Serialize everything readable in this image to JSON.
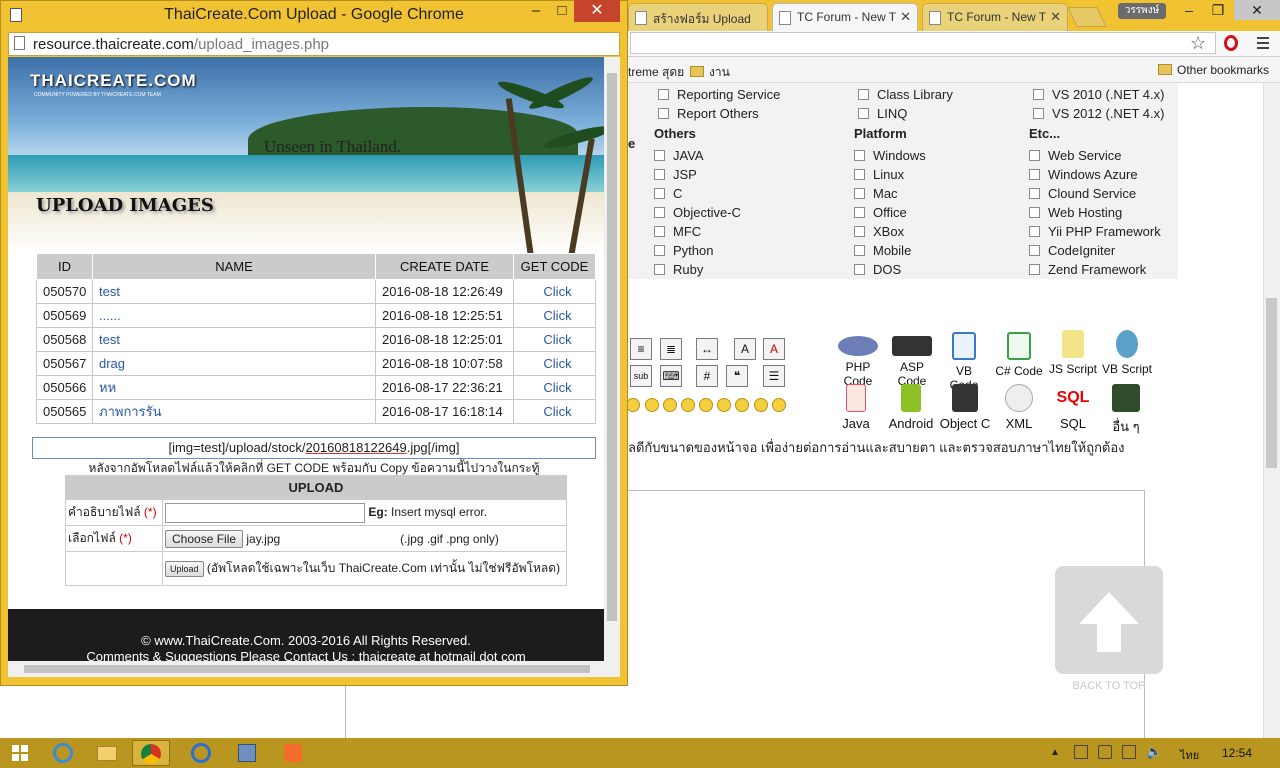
{
  "back_window": {
    "tabs": [
      {
        "label": "สร้างฟอร์ม Upload"
      },
      {
        "label": "TC Forum - New T"
      },
      {
        "label": "TC Forum - New T"
      }
    ],
    "user": "วรรพงษ์",
    "bookmarks": {
      "folder1": "treme สุดย",
      "folder2": "งาน",
      "other": "Other bookmarks"
    },
    "top_items": [
      [
        "Reporting Service",
        "Class Library",
        "VS 2010 (.NET 4.x)"
      ],
      [
        "Report Others",
        "LINQ",
        "VS 2012 (.NET 4.x)"
      ]
    ],
    "partial_heading": "e",
    "columns": [
      {
        "heading": "Others",
        "items": [
          "JAVA",
          "JSP",
          "C",
          "Objective-C",
          "MFC",
          "Python",
          "Ruby"
        ]
      },
      {
        "heading": "Platform",
        "items": [
          "Windows",
          "Linux",
          "Mac",
          "Office",
          "XBox",
          "Mobile",
          "DOS"
        ]
      },
      {
        "heading": "Etc...",
        "items": [
          "Web Service",
          "Windows Azure",
          "Clound Service",
          "Web Hosting",
          "Yii PHP Framework",
          "CodeIgniter",
          "Zend Framework"
        ]
      }
    ],
    "langs_row1": [
      "PHP Code",
      "ASP Code",
      "VB Code",
      "C# Code",
      "JS Script",
      "VB Script"
    ],
    "langs_row2": [
      "Java",
      "Android",
      "Object C",
      "XML",
      "SQL",
      "อื่น ๆ"
    ],
    "toolbar": {
      "sub": "sub"
    },
    "notice": "ลดีกับขนาดของหน้าจอ เพื่อง่ายต่อการอ่านและสบายตา และตรวจสอบภาษาไทยให้ถูกต้อง",
    "back_to_top": "BACK TO TOP"
  },
  "popup": {
    "title": "ThaiCreate.Com Upload - Google Chrome",
    "url_host": "resource.thaicreate.com",
    "url_path": "/upload_images.php",
    "banner": {
      "logo": "THAICREATE.COM",
      "logo_sub": "COMMUNITY POWERED BY THAICREATE.COM TEAM",
      "slogan": "Unseen in Thailand.",
      "heading": "UPLOAD IMAGES"
    },
    "table": {
      "headers": [
        "ID",
        "NAME",
        "CREATE DATE",
        "GET CODE"
      ],
      "rows": [
        {
          "id": "050570",
          "name": "test",
          "date": "2016-08-18 12:26:49",
          "code": "Click"
        },
        {
          "id": "050569",
          "name": "......",
          "date": "2016-08-18 12:25:51",
          "code": "Click"
        },
        {
          "id": "050568",
          "name": "test",
          "date": "2016-08-18 12:25:01",
          "code": "Click"
        },
        {
          "id": "050567",
          "name": "drag",
          "date": "2016-08-18 10:07:58",
          "code": "Click"
        },
        {
          "id": "050566",
          "name": "หห",
          "date": "2016-08-17 22:36:21",
          "code": "Click"
        },
        {
          "id": "050565",
          "name": "ภาพการรัน",
          "date": "2016-08-17 16:18:14",
          "code": "Click"
        }
      ]
    },
    "code_value_pre": "[img=test]/upload/stock/",
    "code_value_file": "20160818122649",
    "code_value_post": ".jpg[/img]",
    "after_note": "หลังจากอัพโหลดไฟล์แล้วให้คลิกที่ GET CODE พร้อมกับ Copy ข้อความนี้ไปวางในกระทู้",
    "form": {
      "heading": "UPLOAD",
      "desc_label": "คำอธิบายไฟล์",
      "required": "(*)",
      "desc_value": "",
      "eg_label": "Eg:",
      "eg_text": "Insert mysql error.",
      "file_label": "เลือกไฟล์",
      "choose_label": "Choose File",
      "file_name": "jay.jpg",
      "file_types": "(.jpg .gif .png only)",
      "upload_label": "Upload",
      "upload_note": "(อัพโหลดใช้เฉพาะในเว็บ ThaiCreate.Com เท่านั้น ไม่ใช่ฟรีอัพโหลด)"
    },
    "footer_line1": "© www.ThaiCreate.Com. 2003-2016 All Rights Reserved.",
    "footer_line2": "Comments & Suggestions Please Contact Us : thaicreate at hotmail dot com"
  },
  "taskbar": {
    "lang": "ไทย",
    "clock": "12:54"
  }
}
